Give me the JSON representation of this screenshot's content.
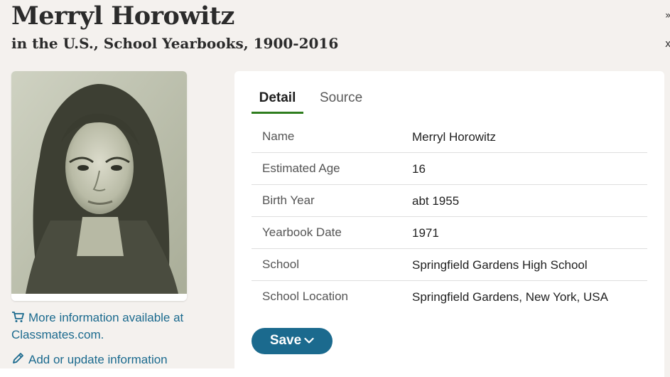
{
  "header": {
    "title": "Merryl Horowitz",
    "subtitle": "in the U.S., School Yearbooks, 1900-2016"
  },
  "sidebar": {
    "photo_icon": "yearbook-portrait-photo",
    "links": [
      {
        "icon": "cart-icon",
        "label": "More information available at Classmates.com."
      },
      {
        "icon": "pencil-icon",
        "label": "Add or update information"
      }
    ]
  },
  "tabs": [
    {
      "label": "Detail",
      "active": true
    },
    {
      "label": "Source",
      "active": false
    }
  ],
  "details": [
    {
      "label": "Name",
      "value": "Merryl Horowitz"
    },
    {
      "label": "Estimated Age",
      "value": "16"
    },
    {
      "label": "Birth Year",
      "value": "abt 1955"
    },
    {
      "label": "Yearbook Date",
      "value": "1971"
    },
    {
      "label": "School",
      "value": "Springfield Gardens High School"
    },
    {
      "label": "School Location",
      "value": "Springfield Gardens, New York, USA"
    }
  ],
  "save_button": {
    "label": "Save",
    "icon": "chevron-down-icon"
  },
  "edge_glyphs": [
    "»",
    "x"
  ],
  "colors": {
    "background": "#f4f1ee",
    "link": "#1b6a8e",
    "button": "#1b6a8e",
    "tab_underline": "#2f7d1e"
  }
}
